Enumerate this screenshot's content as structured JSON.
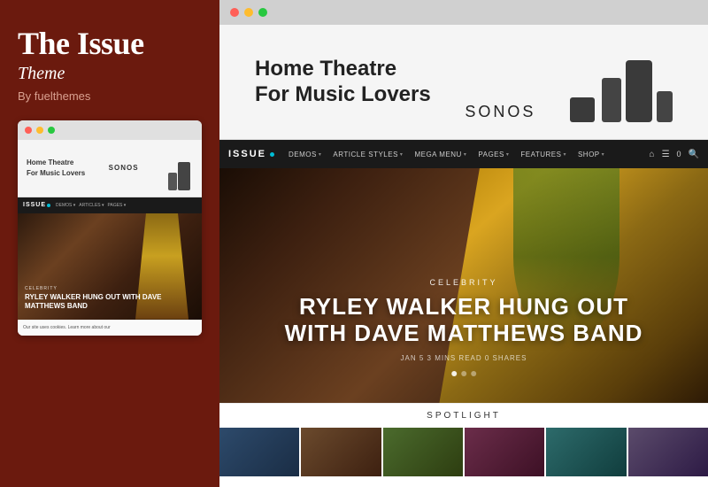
{
  "sidebar": {
    "title": "The Issue",
    "subtitle": "Theme",
    "author": "By fuelthemes",
    "mini_browser": {
      "ad": {
        "text_line1": "Home Theatre",
        "text_line2": "For Music Lovers",
        "brand": "SONOS"
      },
      "nav_logo": "ISSUE",
      "hero": {
        "category": "CELEBRITY",
        "title": "RYLEY WALKER HUNG OUT WITH DAVE MATTHEWS BAND"
      },
      "cookie_text": "Our site uses cookies. Learn more about our"
    }
  },
  "browser": {
    "dots": [
      "red",
      "yellow",
      "green"
    ],
    "ad_banner": {
      "line1": "Home Theatre",
      "line2": "For Music Lovers",
      "brand": "SONOS"
    },
    "nav": {
      "logo": "ISSUE",
      "items": [
        {
          "label": "DEMOS",
          "has_arrow": true
        },
        {
          "label": "ARTICLE STYLES",
          "has_arrow": true
        },
        {
          "label": "MEGA MENU",
          "has_arrow": true
        },
        {
          "label": "PAGES",
          "has_arrow": true
        },
        {
          "label": "FEATURES",
          "has_arrow": true
        },
        {
          "label": "SHOP",
          "has_arrow": true
        }
      ]
    },
    "hero": {
      "category": "CELEBRITY",
      "title_line1": "RYLEY WALKER HUNG OUT",
      "title_line2": "WITH DAVE MATTHEWS BAND",
      "meta": "JAN 5   3 MINS READ   0 SHARES"
    },
    "spotlight": {
      "label": "SPOTLIGHT"
    }
  }
}
